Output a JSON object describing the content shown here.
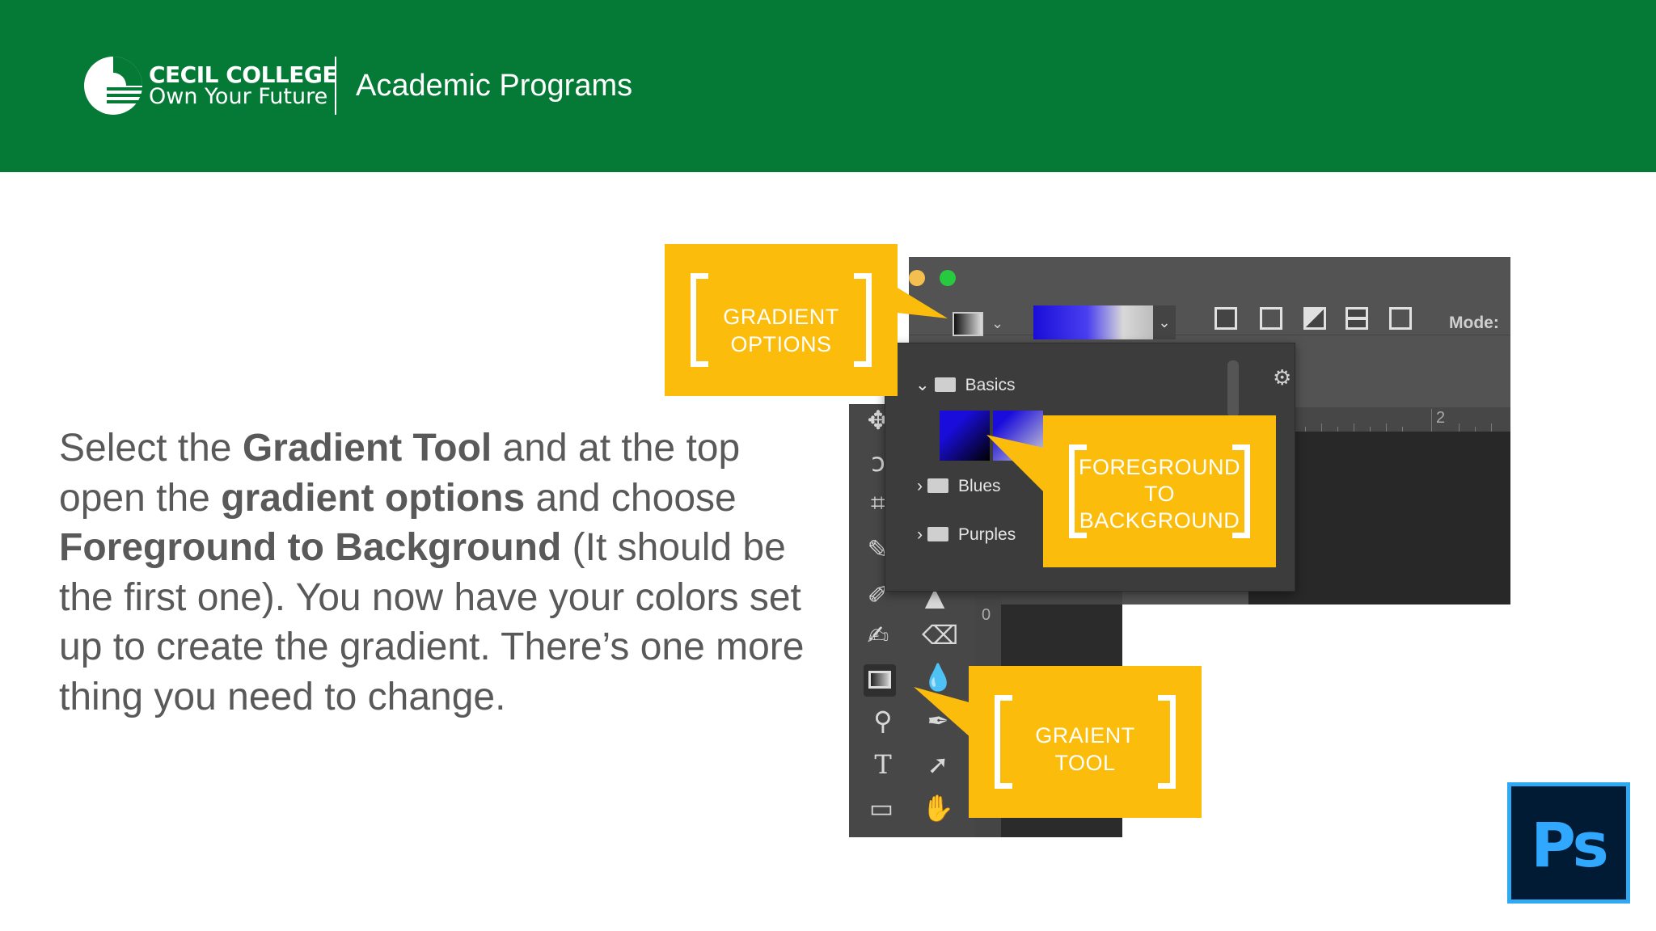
{
  "header": {
    "college_name": "CECIL COLLEGE",
    "tagline": "Own Your Future",
    "section_title": "Academic Programs"
  },
  "instructions": {
    "t1": "Select the ",
    "b1": "Gradient Tool",
    "t2": " and at the top open the ",
    "b2": "gradient options",
    "t3": " and choose ",
    "b3": "Foreground to Background",
    "t4": " (It should be the first one). You now have your colors set up to create the gradient. There’s one more thing you need to change."
  },
  "photoshop": {
    "mode_label": "Mode:",
    "ruler_mark": "2",
    "vruler_mark": "0",
    "gradient_folders": [
      "Basics",
      "Blues",
      "Purples"
    ],
    "icons": [
      "move-icon",
      "lasso-icon",
      "crop-icon",
      "eyedropper-icon",
      "brush-icon",
      "stamp-icon",
      "history-brush-icon",
      "eraser-icon",
      "gradient-tool-icon",
      "blur-icon",
      "dodge-icon",
      "pen-icon",
      "type-icon",
      "path-select-icon",
      "rectangle-icon",
      "hand-icon",
      "gear-icon"
    ]
  },
  "callouts": {
    "gradient_options": {
      "line1": "GRADIENT",
      "line2": "OPTIONS"
    },
    "fg_to_bg": {
      "line1": "FOREGROUND",
      "line2": "TO",
      "line3": "BACKGROUND"
    },
    "gradient_tool": {
      "line1": "GRAIENT",
      "line2": "TOOL"
    }
  },
  "ps_logo": "Ps",
  "colors": {
    "header_green": "#047a36",
    "callout_yellow": "#fcbc0c",
    "body_text": "#595959",
    "ps_blue": "#31a8ff"
  }
}
